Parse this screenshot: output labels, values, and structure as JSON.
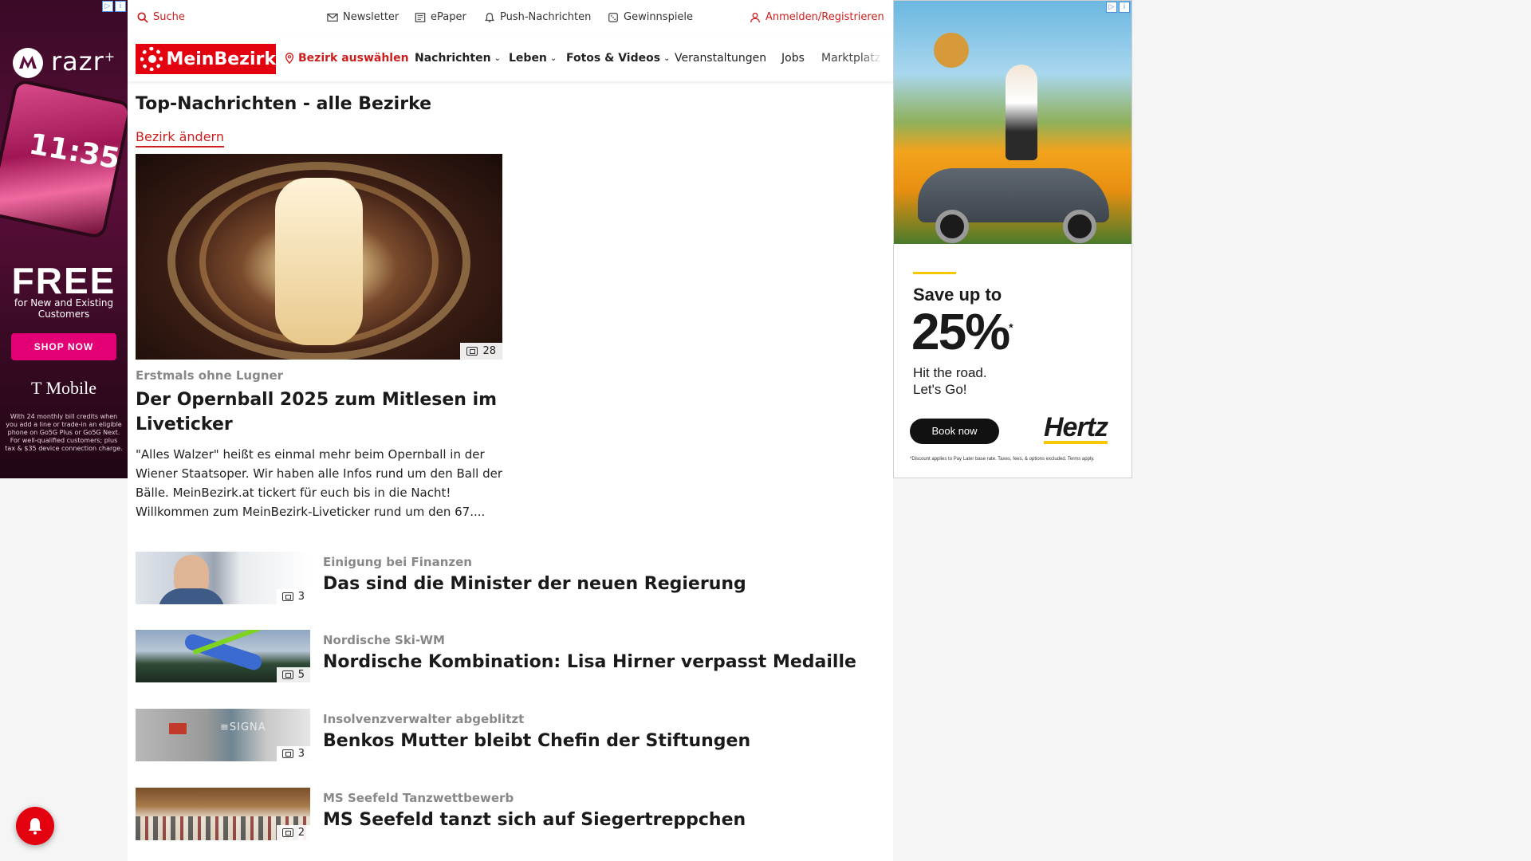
{
  "topbar": {
    "search_label": "Suche",
    "newsletter_label": "Newsletter",
    "epaper_label": "ePaper",
    "push_label": "Push-Nachrichten",
    "gewinnspiele_label": "Gewinnspiele",
    "login_label": "Anmelden/Registrieren"
  },
  "navbar": {
    "logo_text": "MeinBezirk",
    "bezirk_label": "Bezirk auswählen",
    "items": [
      {
        "label": "Nachrichten",
        "has_dropdown": true
      },
      {
        "label": "Leben",
        "has_dropdown": true
      },
      {
        "label": "Fotos & Videos",
        "has_dropdown": true
      },
      {
        "label": "Veranstaltungen",
        "has_dropdown": false
      },
      {
        "label": "Jobs",
        "has_dropdown": false
      },
      {
        "label": "Marktplatz",
        "has_dropdown": false
      }
    ]
  },
  "main": {
    "section_title": "Top-Nachrichten - alle Bezirke",
    "change_bezirk": "Bezirk ändern",
    "hero": {
      "photo_count": "28",
      "kicker": "Erstmals ohne Lugner",
      "title": "Der Opernball 2025 zum Mitlesen im Liveticker",
      "teaser": "\"Alles Walzer\" heißt es einmal mehr beim Opernball in der Wiener Staatsoper. Wir haben alle Infos rund um den Ball der Bälle. MeinBezirk.at tickert für euch bis in die Nacht! Willkommen zum MeinBezirk-Liveticker rund um den 67...."
    },
    "articles": [
      {
        "kicker": "Einigung bei Finanzen",
        "title": "Das sind die Minister der neuen Regierung",
        "photo_count": "3"
      },
      {
        "kicker": "Nordische Ski-WM",
        "title": "Nordische Kombination: Lisa Hirner verpasst Medaille",
        "photo_count": "5"
      },
      {
        "kicker": "Insolvenzverwalter abgeblitzt",
        "title": "Benkos Mutter bleibt Chefin der Stiftungen",
        "photo_count": "3"
      },
      {
        "kicker": "MS Seefeld Tanzwettbewerb",
        "title": "MS Seefeld tanzt sich auf Siegertreppchen",
        "photo_count": "2"
      }
    ]
  },
  "ad_left": {
    "brand": "razr",
    "brand_sup": "+",
    "phone_time": "11:35",
    "headline": "FREE",
    "sub": "for New and Existing Customers",
    "cta": "SHOP NOW",
    "carrier": "T Mobile",
    "fine": "With 24 monthly bill credits when you add a line or trade-in an eligible phone on Go5G Plus or Go5G Next. For well-qualified customers; plus tax & $35 device connection charge."
  },
  "ad_right": {
    "save": "Save up to",
    "percent": "25%",
    "percent_mark": "*",
    "tagline_1": "Hit the road.",
    "tagline_2": "Let's Go!",
    "cta": "Book now",
    "brand": "Hertz",
    "fine": "*Discount applies to Pay Later base rate. Taxes, fees, & options excluded. Terms apply."
  },
  "colors": {
    "brand_red": "#e3000f",
    "link_red": "#cc1f1f",
    "kicker_gray": "#888888",
    "tmobile_magenta": "#e20074",
    "hertz_yellow": "#f7c800"
  }
}
